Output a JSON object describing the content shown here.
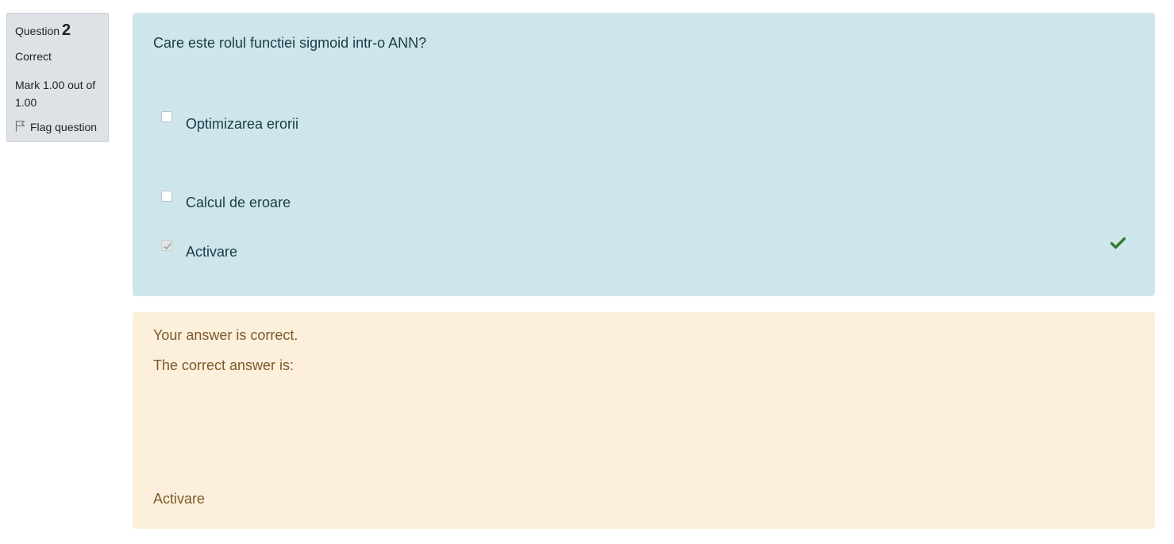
{
  "info": {
    "question_label": "Question",
    "question_number": "2",
    "state": "Correct",
    "grade": "Mark 1.00 out of 1.00",
    "flag_label": "Flag question",
    "flag_icon": "flag-icon"
  },
  "question": {
    "text": "Care este rolul functiei sigmoid intr-o ANN?",
    "options": [
      {
        "label": "Optimizarea erorii",
        "checked": false
      },
      {
        "label": "Calcul de eroare",
        "checked": false
      },
      {
        "label": "Activare",
        "checked": true,
        "mark_icon": "check-icon",
        "mark_color": "#357a32"
      }
    ]
  },
  "feedback": {
    "general": "Your answer is correct.",
    "right_answer_intro": "The correct answer is:",
    "right_answer": "Activare"
  },
  "colors": {
    "info_bg": "#dee2e6",
    "formulation_bg": "#cee6eb",
    "formulation_text": "#1b3a46",
    "feedback_bg": "#fcefdc",
    "feedback_text": "#7d5a29",
    "correct_green": "#357a32"
  }
}
